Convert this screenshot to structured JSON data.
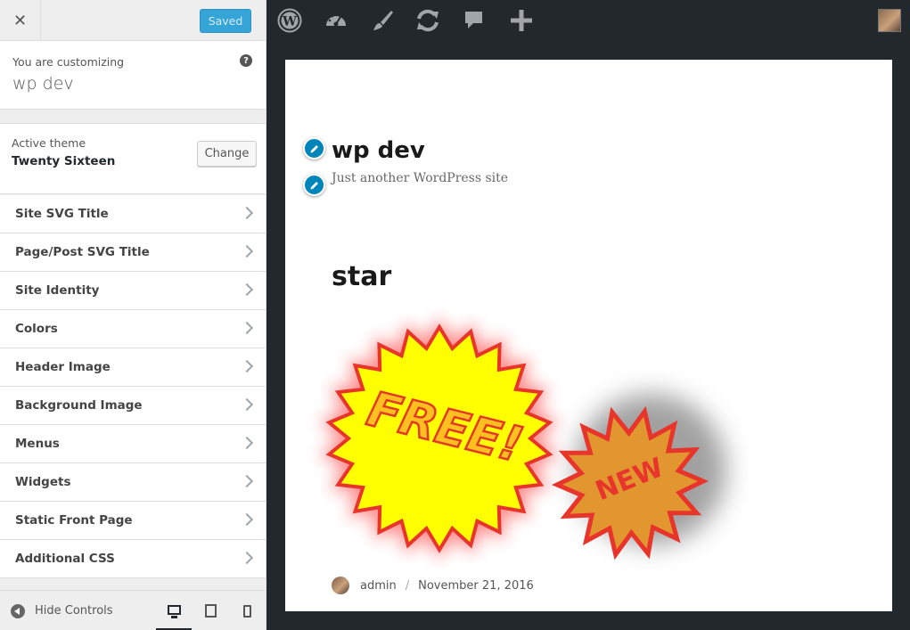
{
  "sidebar": {
    "saved_label": "Saved",
    "customizing_caption": "You are customizing",
    "site_name": "wp dev",
    "active_theme_caption": "Active theme",
    "theme_name": "Twenty Sixteen",
    "change_label": "Change",
    "sections": [
      {
        "label": "Site SVG Title"
      },
      {
        "label": "Page/Post SVG Title"
      },
      {
        "label": "Site Identity"
      },
      {
        "label": "Colors"
      },
      {
        "label": "Header Image"
      },
      {
        "label": "Background Image"
      },
      {
        "label": "Menus"
      },
      {
        "label": "Widgets"
      },
      {
        "label": "Static Front Page"
      },
      {
        "label": "Additional CSS"
      }
    ],
    "hide_controls_label": "Hide Controls"
  },
  "preview": {
    "site_title": "wp dev",
    "tagline": "Just another WordPress site",
    "post_title": "star",
    "badge_free_text": "FREE!",
    "badge_new_text": "NEW",
    "author": "admin",
    "separator": "/",
    "date": "November 21, 2016"
  },
  "colors": {
    "saved_button": "#35a4d7",
    "edit_pencil": "#0085ba",
    "admin_bar": "#23282d",
    "star_yellow": "#ffff00",
    "star_red": "#e8352b",
    "star_orange": "#e2962f"
  }
}
